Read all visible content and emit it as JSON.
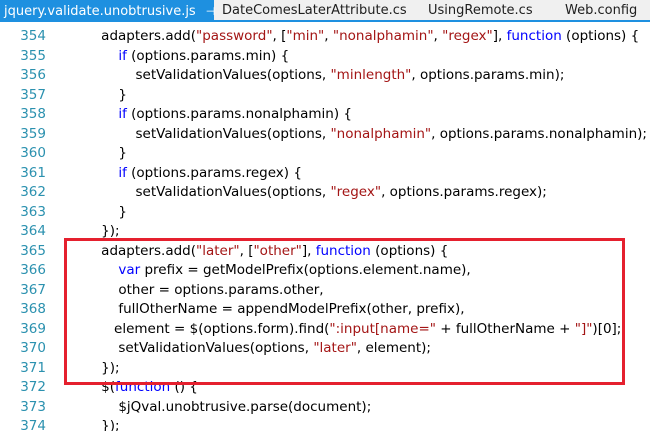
{
  "tabs": [
    {
      "label": "jquery.validate.unobtrusive.js",
      "pin": "⊣",
      "close": "✕",
      "active": true
    },
    {
      "label": "DateComesLaterAttribute.cs"
    },
    {
      "label": "UsingRemote.cs"
    },
    {
      "label": "Web.config"
    }
  ],
  "lines": [
    {
      "num": "354",
      "tokens": [
        [
          "t",
          "    adapters.add("
        ],
        [
          "s",
          "\"password\""
        ],
        [
          "t",
          ", ["
        ],
        [
          "s",
          "\"min\""
        ],
        [
          "t",
          ", "
        ],
        [
          "s",
          "\"nonalphamin\""
        ],
        [
          "t",
          ", "
        ],
        [
          "s",
          "\"regex\""
        ],
        [
          "t",
          "], "
        ],
        [
          "k",
          "function"
        ],
        [
          "t",
          " (options) {"
        ]
      ]
    },
    {
      "num": "355",
      "tokens": [
        [
          "t",
          "        "
        ],
        [
          "k",
          "if"
        ],
        [
          "t",
          " (options.params.min) {"
        ]
      ]
    },
    {
      "num": "356",
      "tokens": [
        [
          "t",
          "            setValidationValues(options, "
        ],
        [
          "s",
          "\"minlength\""
        ],
        [
          "t",
          ", options.params.min);"
        ]
      ]
    },
    {
      "num": "357",
      "tokens": [
        [
          "t",
          "        }"
        ]
      ]
    },
    {
      "num": "358",
      "tokens": [
        [
          "t",
          "        "
        ],
        [
          "k",
          "if"
        ],
        [
          "t",
          " (options.params.nonalphamin) {"
        ]
      ]
    },
    {
      "num": "359",
      "tokens": [
        [
          "t",
          "            setValidationValues(options, "
        ],
        [
          "s",
          "\"nonalphamin\""
        ],
        [
          "t",
          ", options.params.nonalphamin);"
        ]
      ]
    },
    {
      "num": "360",
      "tokens": [
        [
          "t",
          "        }"
        ]
      ]
    },
    {
      "num": "361",
      "tokens": [
        [
          "t",
          "        "
        ],
        [
          "k",
          "if"
        ],
        [
          "t",
          " (options.params.regex) {"
        ]
      ]
    },
    {
      "num": "362",
      "tokens": [
        [
          "t",
          "            setValidationValues(options, "
        ],
        [
          "s",
          "\"regex\""
        ],
        [
          "t",
          ", options.params.regex);"
        ]
      ]
    },
    {
      "num": "363",
      "tokens": [
        [
          "t",
          "        }"
        ]
      ]
    },
    {
      "num": "364",
      "tokens": [
        [
          "t",
          "    });"
        ]
      ]
    },
    {
      "num": "365",
      "tokens": [
        [
          "t",
          "    adapters.add("
        ],
        [
          "s",
          "\"later\""
        ],
        [
          "t",
          ", ["
        ],
        [
          "s",
          "\"other\""
        ],
        [
          "t",
          "], "
        ],
        [
          "k",
          "function"
        ],
        [
          "t",
          " (options) {"
        ]
      ]
    },
    {
      "num": "366",
      "tokens": [
        [
          "t",
          "        "
        ],
        [
          "k",
          "var"
        ],
        [
          "t",
          " prefix = getModelPrefix(options.element.name),"
        ]
      ]
    },
    {
      "num": "367",
      "tokens": [
        [
          "t",
          "        other = options.params.other,"
        ]
      ]
    },
    {
      "num": "368",
      "tokens": [
        [
          "t",
          "        fullOtherName = appendModelPrefix(other, prefix),"
        ]
      ]
    },
    {
      "num": "369",
      "tokens": [
        [
          "t",
          "       element = $(options.form).find("
        ],
        [
          "s",
          "\":input[name=\""
        ],
        [
          "t",
          " + fullOtherName + "
        ],
        [
          "s",
          "\"]\""
        ],
        [
          "t",
          ")[0];"
        ]
      ]
    },
    {
      "num": "370",
      "tokens": [
        [
          "t",
          "        setValidationValues(options, "
        ],
        [
          "s",
          "\"later\""
        ],
        [
          "t",
          ", element);"
        ]
      ]
    },
    {
      "num": "371",
      "tokens": [
        [
          "t",
          "    });"
        ]
      ]
    },
    {
      "num": "372",
      "tokens": [
        [
          "t",
          "    $("
        ],
        [
          "k",
          "function"
        ],
        [
          "t",
          " () {"
        ]
      ]
    },
    {
      "num": "373",
      "tokens": [
        [
          "t",
          "        $jQval.unobtrusive.parse(document);"
        ]
      ]
    },
    {
      "num": "374",
      "tokens": [
        [
          "t",
          "    });"
        ]
      ]
    }
  ],
  "colors": {
    "keyword": "#0000ff",
    "string": "#a31515",
    "line_number": "#2b91af",
    "active_tab": "#1e90e0",
    "highlight_box": "#e5202e",
    "change_bar": "#6ecb3f"
  }
}
